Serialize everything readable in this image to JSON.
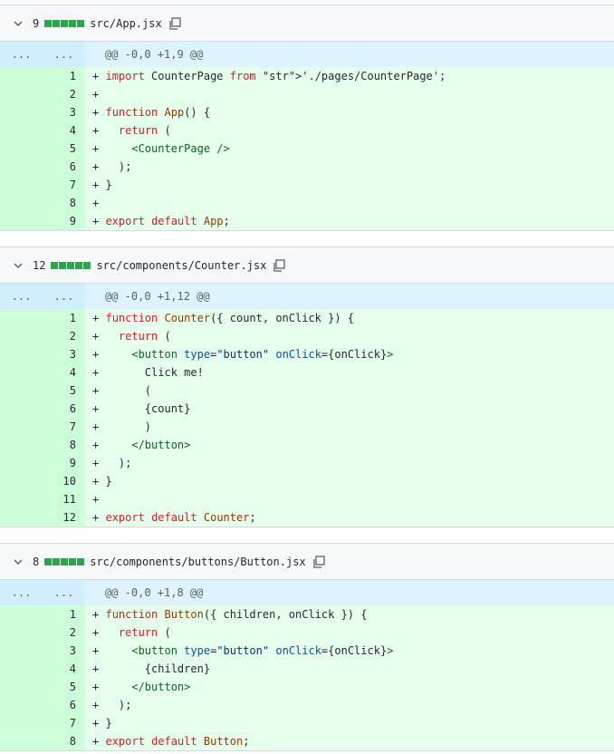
{
  "files": [
    {
      "count": "9",
      "filename": "src/App.jsx",
      "hunk_left": "...",
      "hunk_right": "...",
      "hunk_header": "@@ -0,0 +1,9 @@",
      "lines": [
        {
          "n": "1",
          "text": "+ import CounterPage from './pages/CounterPage';"
        },
        {
          "n": "2",
          "text": "+"
        },
        {
          "n": "3",
          "text": "+ function App() {"
        },
        {
          "n": "4",
          "text": "+   return ("
        },
        {
          "n": "5",
          "text": "+     <CounterPage />"
        },
        {
          "n": "6",
          "text": "+   );"
        },
        {
          "n": "7",
          "text": "+ }"
        },
        {
          "n": "8",
          "text": "+"
        },
        {
          "n": "9",
          "text": "+ export default App;"
        }
      ]
    },
    {
      "count": "12",
      "filename": "src/components/Counter.jsx",
      "hunk_left": "...",
      "hunk_right": "...",
      "hunk_header": "@@ -0,0 +1,12 @@",
      "lines": [
        {
          "n": "1",
          "text": "+ function Counter({ count, onClick }) {"
        },
        {
          "n": "2",
          "text": "+   return ("
        },
        {
          "n": "3",
          "text": "+     <button type=\"button\" onClick={onClick}>"
        },
        {
          "n": "4",
          "text": "+       Click me!"
        },
        {
          "n": "5",
          "text": "+       ("
        },
        {
          "n": "6",
          "text": "+       {count}"
        },
        {
          "n": "7",
          "text": "+       )"
        },
        {
          "n": "8",
          "text": "+     </button>"
        },
        {
          "n": "9",
          "text": "+   );"
        },
        {
          "n": "10",
          "text": "+ }"
        },
        {
          "n": "11",
          "text": "+"
        },
        {
          "n": "12",
          "text": "+ export default Counter;"
        }
      ]
    },
    {
      "count": "8",
      "filename": "src/components/buttons/Button.jsx",
      "hunk_left": "...",
      "hunk_right": "...",
      "hunk_header": "@@ -0,0 +1,8 @@",
      "lines": [
        {
          "n": "1",
          "text": "+ function Button({ children, onClick }) {"
        },
        {
          "n": "2",
          "text": "+   return ("
        },
        {
          "n": "3",
          "text": "+     <button type=\"button\" onClick={onClick}>"
        },
        {
          "n": "4",
          "text": "+       {children}"
        },
        {
          "n": "5",
          "text": "+     </button>"
        },
        {
          "n": "6",
          "text": "+   );"
        },
        {
          "n": "7",
          "text": "+ }"
        },
        {
          "n": "8",
          "text": "+ export default Button;"
        }
      ]
    }
  ],
  "colors": {
    "added_bg": "#e6ffec",
    "added_gutter": "#ccffd8",
    "hunk_bg": "#ddf4ff",
    "diffstat": "#2da44e"
  }
}
